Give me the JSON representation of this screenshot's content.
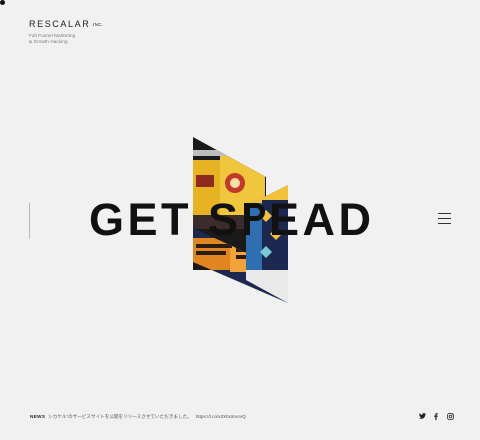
{
  "brand": {
    "logo_text": "RESCALAR",
    "logo_suffix": ".INC.",
    "tagline_line1": "Full Funnel Marketing",
    "tagline_line2": "& Growth Hacking"
  },
  "hero": {
    "headline_part1": "GET S",
    "headline_part2": "EAD",
    "headline_full": "GET SPREAD",
    "image_alt": "Canned beverages photo collage"
  },
  "menu": {
    "icon": "hamburger-menu-icon"
  },
  "news": {
    "label": "NEWS",
    "text": "シカケル\"のサービスサイトを公開をリリースさせていただきました。",
    "url": "https://t.co/x0XbUKvnvQ"
  },
  "social": {
    "twitter": "twitter-icon",
    "facebook": "facebook-icon",
    "instagram": "instagram-icon"
  },
  "colors": {
    "background": "#f1f1f1",
    "text": "#111111",
    "can_yellow": "#f2c23a",
    "can_orange": "#e0851f",
    "can_navy": "#1d2850",
    "can_blue": "#2f6fb0"
  }
}
